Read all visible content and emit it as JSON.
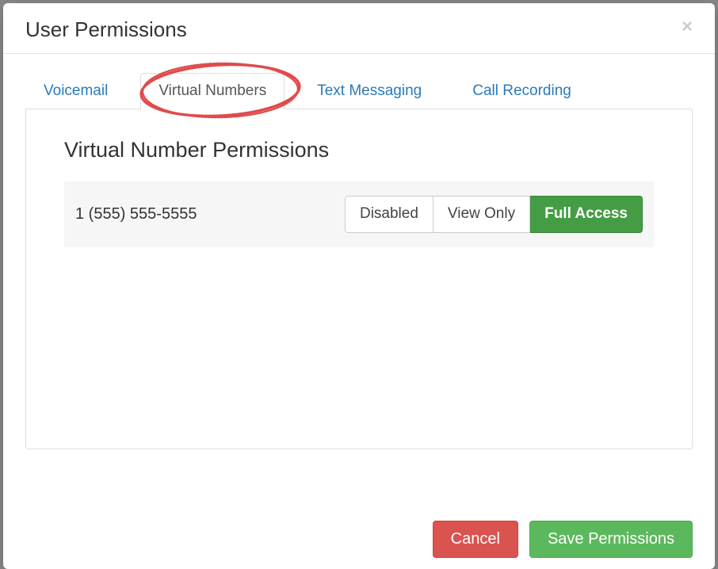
{
  "modal": {
    "title": "User Permissions"
  },
  "tabs": {
    "voicemail": "Voicemail",
    "virtual_numbers": "Virtual Numbers",
    "text_messaging": "Text Messaging",
    "call_recording": "Call Recording",
    "active": "virtual_numbers"
  },
  "panel": {
    "title": "Virtual Number Permissions",
    "rows": [
      {
        "number": "1 (555) 555-5555",
        "permission": "full_access"
      }
    ]
  },
  "permission_options": {
    "disabled": "Disabled",
    "view_only": "View Only",
    "full_access": "Full Access"
  },
  "footer": {
    "cancel": "Cancel",
    "save": "Save Permissions"
  },
  "colors": {
    "link": "#2a7ab9",
    "success": "#5cb85c",
    "success_dark": "#449d44",
    "danger": "#d9534f",
    "annotation": "#e04b4b"
  }
}
